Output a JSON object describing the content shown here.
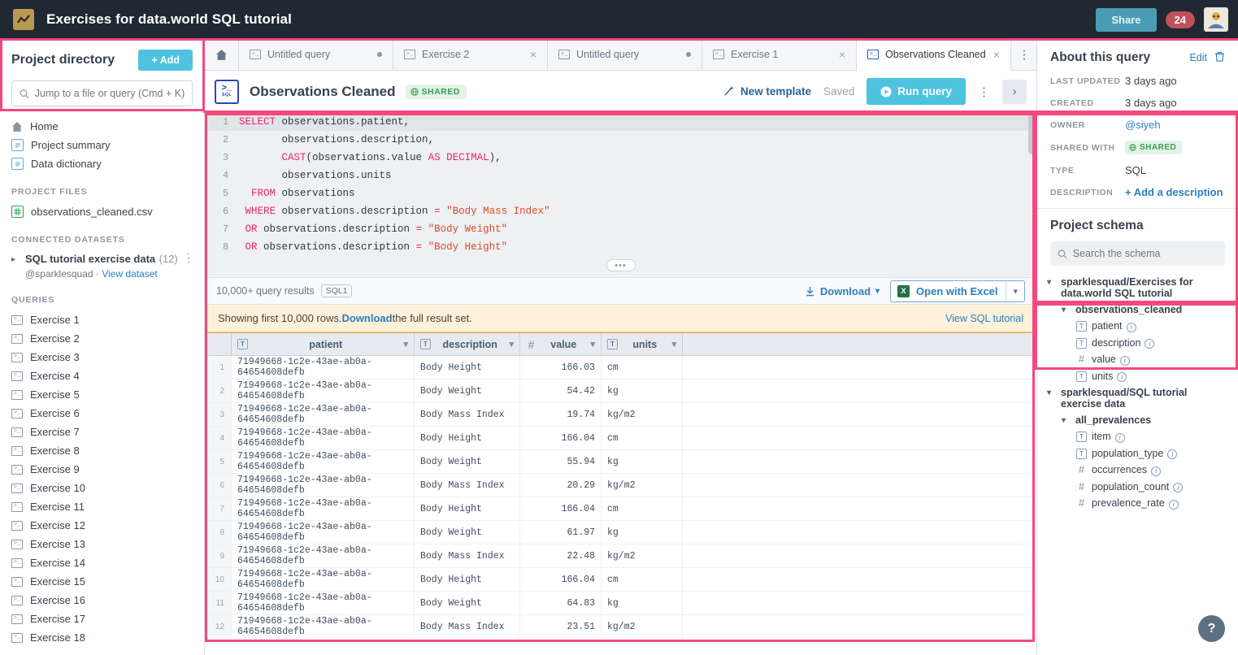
{
  "topbar": {
    "title": "Exercises for data.world SQL tutorial",
    "share_label": "Share",
    "notification_count": "24",
    "logo_icon": "chart-logo-icon",
    "avatar_icon": "user-avatar"
  },
  "sidebar": {
    "title": "Project directory",
    "add_label": "+ Add",
    "search_placeholder": "Jump to a file or query (Cmd + K)",
    "nav": [
      {
        "label": "Home",
        "icon": "home-icon"
      },
      {
        "label": "Project summary",
        "icon": "document-icon"
      },
      {
        "label": "Data dictionary",
        "icon": "document-icon"
      }
    ],
    "project_files_header": "PROJECT FILES",
    "project_files": [
      {
        "label": "observations_cleaned.csv",
        "icon": "spreadsheet-icon"
      }
    ],
    "connected_datasets_header": "CONNECTED DATASETS",
    "dataset": {
      "name": "SQL tutorial exercise data",
      "count": "(12)",
      "owner": "@sparklesquad",
      "separator": "·",
      "view_label": "View dataset"
    },
    "queries_header": "QUERIES",
    "queries": [
      "Exercise 1",
      "Exercise 2",
      "Exercise 3",
      "Exercise 4",
      "Exercise 5",
      "Exercise 6",
      "Exercise 7",
      "Exercise 8",
      "Exercise 9",
      "Exercise 10",
      "Exercise 11",
      "Exercise 12",
      "Exercise 13",
      "Exercise 14",
      "Exercise 15",
      "Exercise 16",
      "Exercise 17",
      "Exercise 18"
    ]
  },
  "tabs": {
    "home_icon": "home-icon",
    "items": [
      {
        "label": "Untitled query",
        "state": "dot",
        "active": false
      },
      {
        "label": "Exercise 2",
        "state": "close",
        "active": false
      },
      {
        "label": "Untitled query",
        "state": "dot",
        "active": false
      },
      {
        "label": "Exercise 1",
        "state": "close",
        "active": false
      },
      {
        "label": "Observations Cleaned",
        "state": "close",
        "active": true
      }
    ],
    "overflow_icon": "kebab-menu-icon"
  },
  "query_header": {
    "title": "Observations Cleaned",
    "badge": "SQL",
    "shared_label": "SHARED",
    "new_template_label": "New template",
    "saved_label": "Saved",
    "run_label": "Run query",
    "kebab_icon": "kebab-menu-icon",
    "expand_icon": "chevron-right-icon"
  },
  "editor": {
    "lines": [
      {
        "n": "1",
        "html": "<span class=\"kw\">SELECT</span> observations.patient,"
      },
      {
        "n": "2",
        "html": "       observations.description,"
      },
      {
        "n": "3",
        "html": "       <span class=\"kw\">CAST</span>(observations.value <span class=\"kw\">AS DECIMAL</span>),"
      },
      {
        "n": "4",
        "html": "       observations.units"
      },
      {
        "n": "5",
        "html": "  <span class=\"kw\">FROM</span> observations"
      },
      {
        "n": "6",
        "html": " <span class=\"kw\">WHERE</span> observations.description <span class=\"kw\">=</span> <span class=\"str\">\"Body Mass Index\"</span>"
      },
      {
        "n": "7",
        "html": " <span class=\"kw\">OR</span> observations.description <span class=\"kw\">=</span> <span class=\"str\">\"Body Weight\"</span>"
      },
      {
        "n": "8",
        "html": " <span class=\"kw\">OR</span> observations.description <span class=\"kw\">=</span> <span class=\"str\">\"Body Height\"</span>"
      }
    ],
    "resize_handle": "•••"
  },
  "results_toolbar": {
    "count_label": "10,000+ query results",
    "sql_chip": "SQL1",
    "download_label": "Download",
    "excel_label": "Open with Excel"
  },
  "notice": {
    "prefix": "Showing first 10,000 rows. ",
    "link": "Download",
    "suffix": " the full result set.",
    "right_link": "View SQL tutorial"
  },
  "table": {
    "columns": [
      {
        "name": "patient",
        "type": "text"
      },
      {
        "name": "description",
        "type": "text"
      },
      {
        "name": "value",
        "type": "number"
      },
      {
        "name": "units",
        "type": "text"
      }
    ],
    "rows": [
      {
        "n": "1",
        "patient": "71949668-1c2e-43ae-ab0a-64654608defb",
        "description": "Body Height",
        "value": "166.03",
        "units": "cm"
      },
      {
        "n": "2",
        "patient": "71949668-1c2e-43ae-ab0a-64654608defb",
        "description": "Body Weight",
        "value": "54.42",
        "units": "kg"
      },
      {
        "n": "3",
        "patient": "71949668-1c2e-43ae-ab0a-64654608defb",
        "description": "Body Mass Index",
        "value": "19.74",
        "units": "kg/m2"
      },
      {
        "n": "4",
        "patient": "71949668-1c2e-43ae-ab0a-64654608defb",
        "description": "Body Height",
        "value": "166.04",
        "units": "cm"
      },
      {
        "n": "5",
        "patient": "71949668-1c2e-43ae-ab0a-64654608defb",
        "description": "Body Weight",
        "value": "55.94",
        "units": "kg"
      },
      {
        "n": "6",
        "patient": "71949668-1c2e-43ae-ab0a-64654608defb",
        "description": "Body Mass Index",
        "value": "20.29",
        "units": "kg/m2"
      },
      {
        "n": "7",
        "patient": "71949668-1c2e-43ae-ab0a-64654608defb",
        "description": "Body Height",
        "value": "166.04",
        "units": "cm"
      },
      {
        "n": "8",
        "patient": "71949668-1c2e-43ae-ab0a-64654608defb",
        "description": "Body Weight",
        "value": "61.97",
        "units": "kg"
      },
      {
        "n": "9",
        "patient": "71949668-1c2e-43ae-ab0a-64654608defb",
        "description": "Body Mass Index",
        "value": "22.48",
        "units": "kg/m2"
      },
      {
        "n": "10",
        "patient": "71949668-1c2e-43ae-ab0a-64654608defb",
        "description": "Body Height",
        "value": "166.04",
        "units": "cm"
      },
      {
        "n": "11",
        "patient": "71949668-1c2e-43ae-ab0a-64654608defb",
        "description": "Body Weight",
        "value": "64.83",
        "units": "kg"
      },
      {
        "n": "12",
        "patient": "71949668-1c2e-43ae-ab0a-64654608defb",
        "description": "Body Mass Index",
        "value": "23.51",
        "units": "kg/m2"
      }
    ]
  },
  "about": {
    "title": "About this query",
    "edit_label": "Edit",
    "delete_icon": "trash-icon",
    "fields": [
      {
        "key": "LAST UPDATED",
        "value": "3 days ago",
        "kind": "text"
      },
      {
        "key": "CREATED",
        "value": "3 days ago",
        "kind": "text"
      },
      {
        "key": "OWNER",
        "value": "@siyeh",
        "kind": "link"
      },
      {
        "key": "SHARED WITH",
        "value": "SHARED",
        "kind": "pill"
      },
      {
        "key": "TYPE",
        "value": "SQL",
        "kind": "text"
      },
      {
        "key": "DESCRIPTION",
        "value": "+ Add a description",
        "kind": "action"
      }
    ]
  },
  "schema": {
    "title": "Project schema",
    "search_placeholder": "Search the schema",
    "tree": [
      {
        "level": 0,
        "label": "sparklesquad/Exercises for data.world SQL tutorial",
        "icon": "chevron-down-icon"
      },
      {
        "level": 1,
        "label": "observations_cleaned",
        "icon": "chevron-down-icon"
      },
      {
        "level": 2,
        "label": "patient",
        "icon": "text-column-icon"
      },
      {
        "level": 2,
        "label": "description",
        "icon": "text-column-icon"
      },
      {
        "level": 2,
        "label": "value",
        "icon": "number-column-icon"
      },
      {
        "level": 2,
        "label": "units",
        "icon": "text-column-icon"
      },
      {
        "level": 0,
        "label": "sparklesquad/SQL tutorial exercise data",
        "icon": "chevron-down-icon"
      },
      {
        "level": 1,
        "label": "all_prevalences",
        "icon": "chevron-down-icon"
      },
      {
        "level": 2,
        "label": "item",
        "icon": "text-column-icon"
      },
      {
        "level": 2,
        "label": "population_type",
        "icon": "text-column-icon"
      },
      {
        "level": 2,
        "label": "occurrences",
        "icon": "number-column-icon"
      },
      {
        "level": 2,
        "label": "population_count",
        "icon": "number-column-icon"
      },
      {
        "level": 2,
        "label": "prevalence_rate",
        "icon": "number-column-icon"
      }
    ]
  },
  "help": {
    "label": "?"
  },
  "colors": {
    "accent": "#4ec3e0",
    "highlight": "#f4487e",
    "topbar_bg": "#1f2833",
    "link": "#2a7fbf",
    "shared_green": "#3c9a54",
    "notice_bg": "#fdf1d9"
  }
}
